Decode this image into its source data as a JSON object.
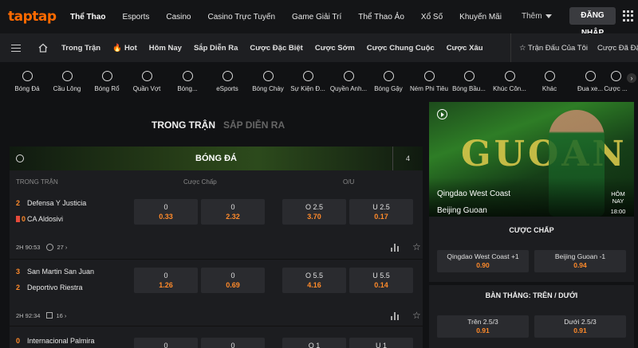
{
  "brand": {
    "logo": "taptap",
    "accent": "#ff6a00"
  },
  "topnav": {
    "items": [
      "Thể Thao",
      "Esports",
      "Casino",
      "Casino Trực Tuyến",
      "Game Giải Trí",
      "Thể Thao Ảo",
      "Xổ Số",
      "Khuyến Mãi"
    ],
    "more": "Thêm",
    "login": "ĐĂNG NHẬP"
  },
  "subnav": {
    "items": [
      "Trong Trận",
      "Hot",
      "Hôm Nay",
      "Sắp Diễn Ra",
      "Cược Đặc Biệt",
      "Cược Sớm",
      "Cược Chung Cuộc",
      "Cược Xâu"
    ],
    "right": [
      "Trận Đấu Của Tôi",
      "Cược Đã Đặt"
    ]
  },
  "sports": [
    "Bóng Đá",
    "Cầu Lông",
    "Bóng Rổ",
    "Quần Vợt",
    "Bóng...",
    "eSports",
    "Bóng Chày",
    "Sự Kiện Đ...",
    "Quyền Anh...",
    "Bóng Gậy",
    "Ném Phi Tiêu",
    "Bóng Bầu...",
    "Khúc Côn...",
    "Khác",
    "Đua xe...",
    "Cược ..."
  ],
  "section_tabs": [
    "TRONG TRẬN",
    "SẮP DIỄN RA"
  ],
  "panel": {
    "title": "BÓNG ĐÁ",
    "count": "4",
    "col_live": "TRONG TRẬN",
    "col_handicap": "Cược Chấp",
    "col_ou": "O/U"
  },
  "matches": [
    {
      "home_score": "2",
      "home": "Defensa Y Justicia",
      "away_score": "0",
      "away": "CA Aldosivi",
      "odds": [
        [
          "0",
          "0.33"
        ],
        [
          "0",
          "2.32"
        ],
        [
          "O 2.5",
          "3.70"
        ],
        [
          "U 2.5",
          "0.17"
        ]
      ],
      "time": "2H 90:53",
      "markets": "27"
    },
    {
      "home_score": "3",
      "home": "San Martin San Juan",
      "away_score": "2",
      "away": "Deportivo Riestra",
      "odds": [
        [
          "0",
          "1.26"
        ],
        [
          "0",
          "0.69"
        ],
        [
          "O 5.5",
          "4.16"
        ],
        [
          "U 5.5",
          "0.14"
        ]
      ],
      "time": "2H 92:34",
      "markets": "16"
    },
    {
      "home_score": "0",
      "home": "Internacional Palmira",
      "odds": [
        [
          "0",
          ""
        ],
        [
          "0",
          ""
        ],
        [
          "O 1",
          ""
        ],
        [
          "U 1",
          ""
        ]
      ]
    }
  ],
  "featured": {
    "bigtext": "GUOAN",
    "home": "Qingdao West Coast",
    "away": "Beijing Guoan",
    "day": "HÔM NAY",
    "time": "18:00",
    "handicap_title": "CƯỢC CHẤP",
    "handicap": [
      [
        "Qingdao West Coast +1",
        "0.90"
      ],
      [
        "Beijing Guoan -1",
        "0.94"
      ]
    ],
    "ou_title": "BÀN THẮNG: TRÊN / DƯỚI",
    "ou": [
      [
        "Trên 2.5/3",
        "0.91"
      ],
      [
        "Dưới 2.5/3",
        "0.91"
      ]
    ]
  }
}
